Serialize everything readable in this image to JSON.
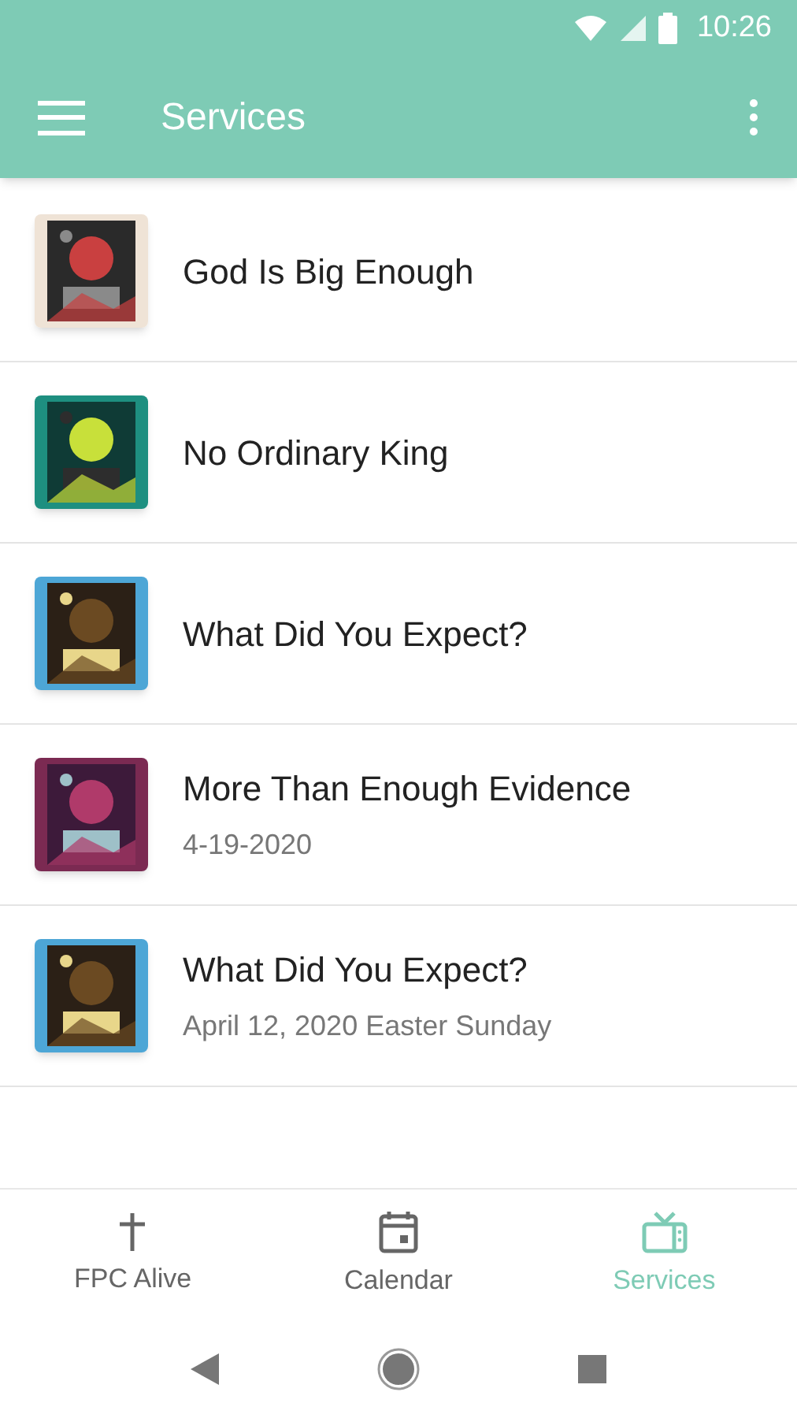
{
  "status_bar": {
    "time": "10:26"
  },
  "app_bar": {
    "title": "Services"
  },
  "services": [
    {
      "title": "God Is Big Enough"
    },
    {
      "title": "No Ordinary King"
    },
    {
      "title": "What Did You Expect?"
    },
    {
      "title": "More Than Enough Evidence",
      "subtitle": "4-19-2020"
    },
    {
      "title": "What Did You Expect?",
      "subtitle": "April 12, 2020 Easter Sunday"
    }
  ],
  "bottom_nav": [
    {
      "kind": "cross",
      "label": "FPC Alive",
      "selected": false
    },
    {
      "kind": "calendar",
      "label": "Calendar",
      "selected": false
    },
    {
      "kind": "tv",
      "label": "Services",
      "selected": true
    }
  ]
}
